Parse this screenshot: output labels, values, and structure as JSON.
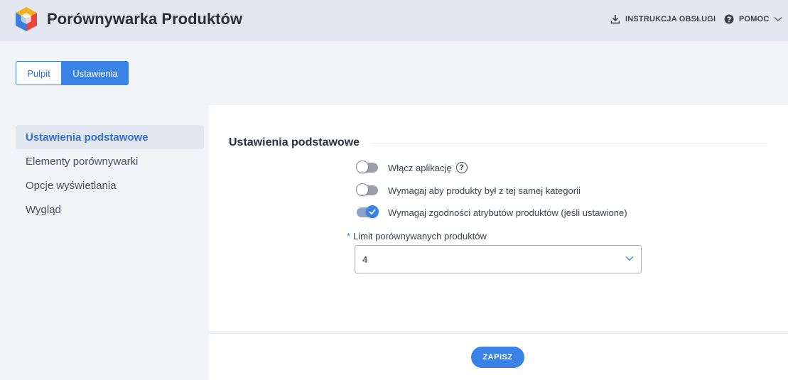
{
  "header": {
    "title": "Porównywarka Produktów",
    "manual_label": "INSTRUKCJA OBSŁUGI",
    "help_label": "POMOC",
    "icons": {
      "logo": "cube-logo-icon",
      "manual": "download-icon",
      "help": "question-circle-icon",
      "help_dropdown": "chevron-down-icon"
    }
  },
  "tabs": [
    {
      "label": "Pulpit",
      "active": false
    },
    {
      "label": "Ustawienia",
      "active": true
    }
  ],
  "sidebar": {
    "items": [
      {
        "label": "Ustawienia podstawowe",
        "active": true
      },
      {
        "label": "Elementy porównywarki",
        "active": false
      },
      {
        "label": "Opcje wyświetlania",
        "active": false
      },
      {
        "label": "Wygląd",
        "active": false
      }
    ]
  },
  "settings": {
    "section_title": "Ustawienia podstawowe",
    "toggles": [
      {
        "label": "Włącz aplikację",
        "on": false,
        "help_icon": "?"
      },
      {
        "label": "Wymagaj aby produkty był z tej samej kategorii",
        "on": false
      },
      {
        "label": "Wymagaj zgodności atrybutów produktów (jeśli ustawione)",
        "on": true
      }
    ],
    "limit": {
      "required_mark": "*",
      "label": "Limit porównywanych produktów",
      "value": "4"
    }
  },
  "footer": {
    "save_label": "ZAPISZ"
  },
  "colors": {
    "accent": "#3b82e6",
    "header_bg": "#e2e7f1",
    "page_bg": "#f3f4f7"
  }
}
